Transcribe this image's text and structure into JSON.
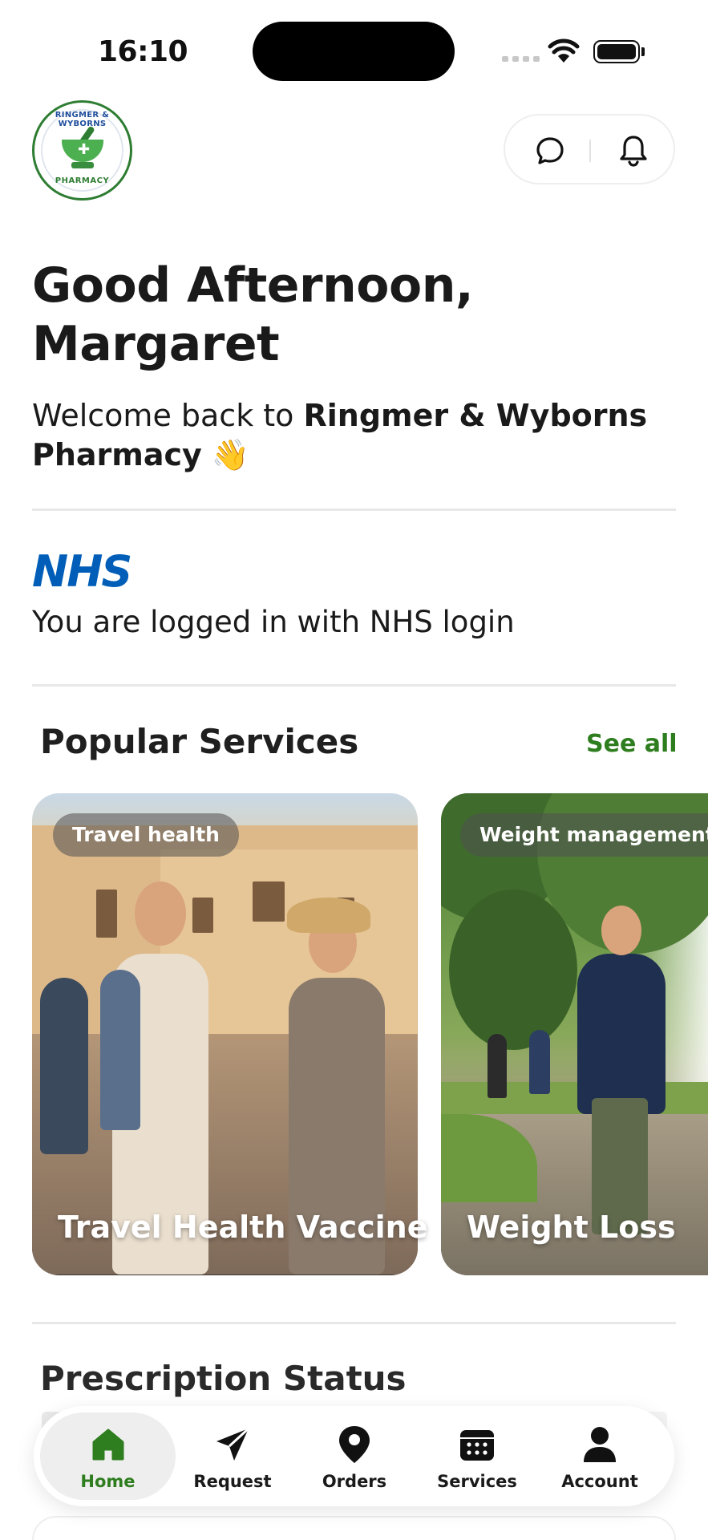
{
  "status_bar": {
    "time": "16:10"
  },
  "header": {
    "logo": {
      "top_text": "RINGMER & WYBORNS",
      "bottom_text": "PHARMACY",
      "icon": "mortar-pestle-icon"
    },
    "chat_icon": "chat-bubble-icon",
    "notifications_icon": "bell-icon"
  },
  "greeting": {
    "line1": "Good Afternoon,",
    "line2": "Margaret",
    "welcome_prefix": "Welcome back to ",
    "pharmacy_name_line1": "Ringmer & Wyborns",
    "pharmacy_name_line2": "Pharmacy",
    "emoji": "👋"
  },
  "nhs": {
    "logo_text": "NHS",
    "status_text": "You are logged in with NHS login"
  },
  "popular_services": {
    "title": "Popular Services",
    "see_all": "See all",
    "cards": [
      {
        "tag": "Travel health",
        "title": "Travel Health Vaccine"
      },
      {
        "tag": "Weight management",
        "title": "Weight Loss"
      }
    ]
  },
  "prescription": {
    "title": "Prescription Status"
  },
  "bottom_nav": {
    "items": [
      {
        "label": "Home",
        "icon": "home-icon",
        "active": true
      },
      {
        "label": "Request",
        "icon": "paper-plane-icon",
        "active": false
      },
      {
        "label": "Orders",
        "icon": "map-pin-icon",
        "active": false
      },
      {
        "label": "Services",
        "icon": "calendar-icon",
        "active": false
      },
      {
        "label": "Account",
        "icon": "user-icon",
        "active": false
      }
    ]
  },
  "colors": {
    "accent_green": "#2e7d1e",
    "nhs_blue": "#005eb8",
    "text": "#1a1a1a"
  }
}
